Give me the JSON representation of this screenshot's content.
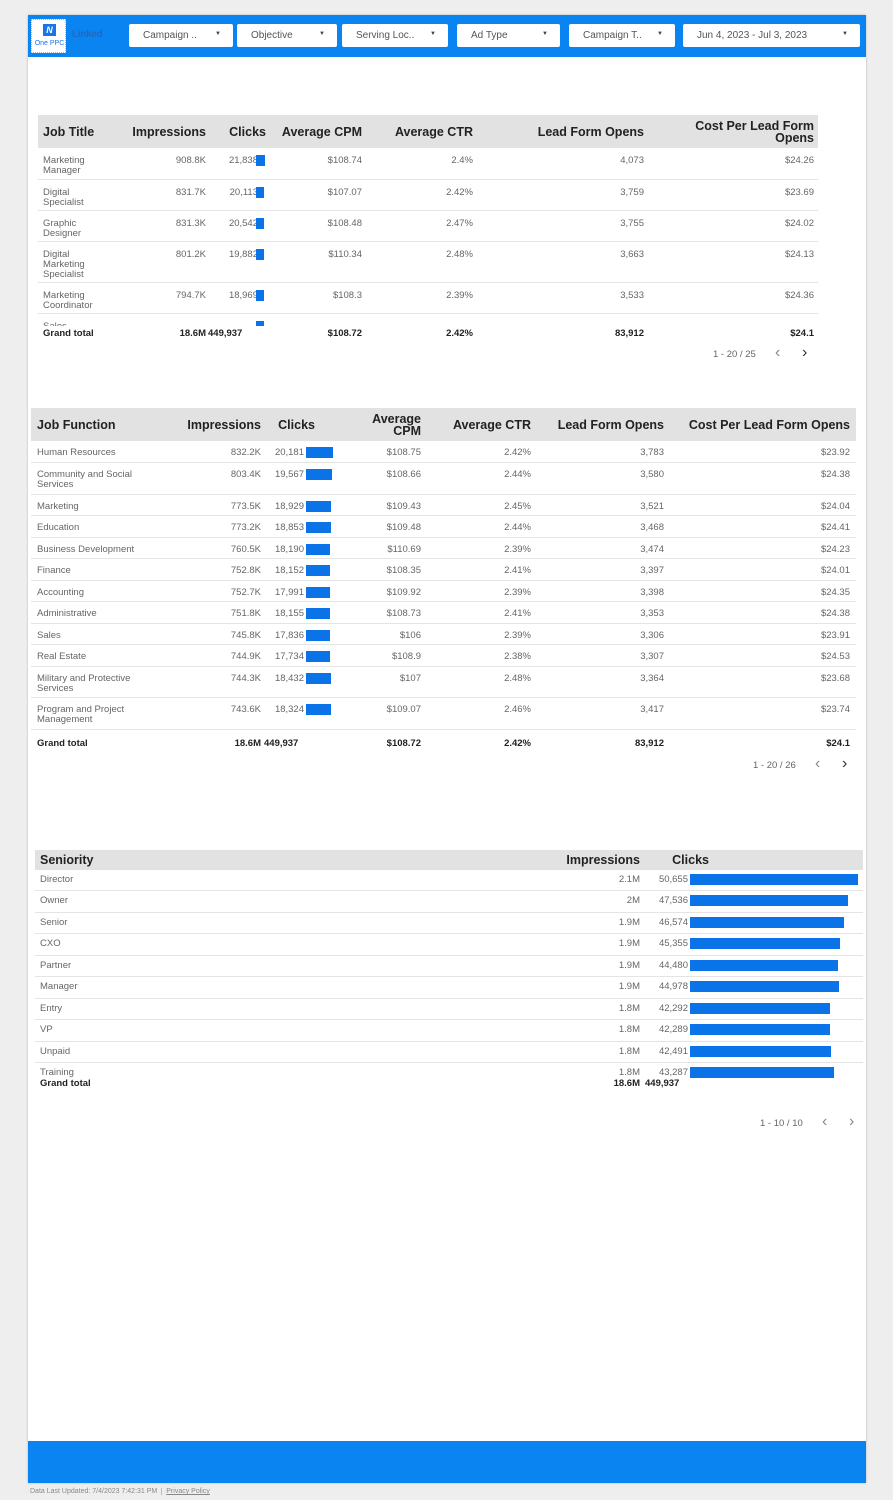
{
  "header": {
    "logo_text": "One PPC",
    "logo_mark": "N",
    "platform_label": "Linked",
    "filters": [
      {
        "label": "Campaign ..",
        "left": 0
      },
      {
        "label": "Objective"
      },
      {
        "label": "Serving Loc.."
      },
      {
        "label": "Ad Type"
      },
      {
        "label": "Campaign T.."
      },
      {
        "label": "Jun 4, 2023 - Jul 3, 2023"
      }
    ]
  },
  "colors": {
    "brand": "#0a84f0",
    "bar": "#0a73e8",
    "header_bg": "#e2e2e2"
  },
  "job_title_table": {
    "headers": [
      "Job Title",
      "Impressions",
      "Clicks",
      "Average CPM",
      "Average CTR",
      "Lead Form Opens",
      "Cost Per Lead Form Opens"
    ],
    "rows": [
      {
        "name": "Marketing Manager",
        "impressions": "908.8K",
        "clicks": "21,838",
        "clicks_value": 21838,
        "cpm": "$108.74",
        "ctr": "2.4%",
        "lfo": "4,073",
        "cplfo": "$24.26"
      },
      {
        "name": "Digital Specialist",
        "impressions": "831.7K",
        "clicks": "20,113",
        "clicks_value": 20113,
        "cpm": "$107.07",
        "ctr": "2.42%",
        "lfo": "3,759",
        "cplfo": "$23.69"
      },
      {
        "name": "Graphic Designer",
        "impressions": "831.3K",
        "clicks": "20,542",
        "clicks_value": 20542,
        "cpm": "$108.48",
        "ctr": "2.47%",
        "lfo": "3,755",
        "cplfo": "$24.02"
      },
      {
        "name": "Digital Marketing Specialist",
        "impressions": "801.2K",
        "clicks": "19,882",
        "clicks_value": 19882,
        "cpm": "$110.34",
        "ctr": "2.48%",
        "lfo": "3,663",
        "cplfo": "$24.13"
      },
      {
        "name": "Marketing Coordinator",
        "impressions": "794.7K",
        "clicks": "18,969",
        "clicks_value": 18969,
        "cpm": "$108.3",
        "ctr": "2.39%",
        "lfo": "3,533",
        "cplfo": "$24.36"
      },
      {
        "name": "Sales",
        "impressions": "",
        "clicks": "",
        "clicks_value": 19000,
        "cpm": "",
        "ctr": "",
        "lfo": "",
        "cplfo": ""
      }
    ],
    "total": {
      "name": "Grand total",
      "impressions": "18.6M",
      "clicks": "449,937",
      "cpm": "$108.72",
      "ctr": "2.42%",
      "lfo": "83,912",
      "cplfo": "$24.1"
    },
    "pagination": "1 - 20 / 25"
  },
  "job_function_table": {
    "headers": [
      "Job Function",
      "Impressions",
      "Clicks",
      "Average CPM",
      "Average CTR",
      "Lead Form Opens",
      "Cost Per Lead Form Opens"
    ],
    "rows": [
      {
        "name": "Human Resources",
        "impressions": "832.2K",
        "clicks": "20,181",
        "clicks_value": 20181,
        "cpm": "$108.75",
        "ctr": "2.42%",
        "lfo": "3,783",
        "cplfo": "$23.92"
      },
      {
        "name": "Community and Social Services",
        "impressions": "803.4K",
        "clicks": "19,567",
        "clicks_value": 19567,
        "cpm": "$108.66",
        "ctr": "2.44%",
        "lfo": "3,580",
        "cplfo": "$24.38"
      },
      {
        "name": "Marketing",
        "impressions": "773.5K",
        "clicks": "18,929",
        "clicks_value": 18929,
        "cpm": "$109.43",
        "ctr": "2.45%",
        "lfo": "3,521",
        "cplfo": "$24.04"
      },
      {
        "name": "Education",
        "impressions": "773.2K",
        "clicks": "18,853",
        "clicks_value": 18853,
        "cpm": "$109.48",
        "ctr": "2.44%",
        "lfo": "3,468",
        "cplfo": "$24.41"
      },
      {
        "name": "Business Development",
        "impressions": "760.5K",
        "clicks": "18,190",
        "clicks_value": 18190,
        "cpm": "$110.69",
        "ctr": "2.39%",
        "lfo": "3,474",
        "cplfo": "$24.23"
      },
      {
        "name": "Finance",
        "impressions": "752.8K",
        "clicks": "18,152",
        "clicks_value": 18152,
        "cpm": "$108.35",
        "ctr": "2.41%",
        "lfo": "3,397",
        "cplfo": "$24.01"
      },
      {
        "name": "Accounting",
        "impressions": "752.7K",
        "clicks": "17,991",
        "clicks_value": 17991,
        "cpm": "$109.92",
        "ctr": "2.39%",
        "lfo": "3,398",
        "cplfo": "$24.35"
      },
      {
        "name": "Administrative",
        "impressions": "751.8K",
        "clicks": "18,155",
        "clicks_value": 18155,
        "cpm": "$108.73",
        "ctr": "2.41%",
        "lfo": "3,353",
        "cplfo": "$24.38"
      },
      {
        "name": "Sales",
        "impressions": "745.8K",
        "clicks": "17,836",
        "clicks_value": 17836,
        "cpm": "$106",
        "ctr": "2.39%",
        "lfo": "3,306",
        "cplfo": "$23.91"
      },
      {
        "name": "Real Estate",
        "impressions": "744.9K",
        "clicks": "17,734",
        "clicks_value": 17734,
        "cpm": "$108.9",
        "ctr": "2.38%",
        "lfo": "3,307",
        "cplfo": "$24.53"
      },
      {
        "name": "Military and Protective Services",
        "impressions": "744.3K",
        "clicks": "18,432",
        "clicks_value": 18432,
        "cpm": "$107",
        "ctr": "2.48%",
        "lfo": "3,364",
        "cplfo": "$23.68"
      },
      {
        "name": "Program and Project Management",
        "impressions": "743.6K",
        "clicks": "18,324",
        "clicks_value": 18324,
        "cpm": "$109.07",
        "ctr": "2.46%",
        "lfo": "3,417",
        "cplfo": "$23.74"
      }
    ],
    "total": {
      "name": "Grand total",
      "impressions": "18.6M",
      "clicks": "449,937",
      "cpm": "$108.72",
      "ctr": "2.42%",
      "lfo": "83,912",
      "cplfo": "$24.1"
    },
    "pagination": "1 - 20 / 26"
  },
  "seniority_table": {
    "headers": [
      "Seniority",
      "Impressions",
      "Clicks"
    ],
    "rows": [
      {
        "name": "Director",
        "impressions": "2.1M",
        "clicks": "50,655",
        "clicks_value": 50655
      },
      {
        "name": "Owner",
        "impressions": "2M",
        "clicks": "47,536",
        "clicks_value": 47536
      },
      {
        "name": "Senior",
        "impressions": "1.9M",
        "clicks": "46,574",
        "clicks_value": 46574
      },
      {
        "name": "CXO",
        "impressions": "1.9M",
        "clicks": "45,355",
        "clicks_value": 45355
      },
      {
        "name": "Partner",
        "impressions": "1.9M",
        "clicks": "44,480",
        "clicks_value": 44480
      },
      {
        "name": "Manager",
        "impressions": "1.9M",
        "clicks": "44,978",
        "clicks_value": 44978
      },
      {
        "name": "Entry",
        "impressions": "1.8M",
        "clicks": "42,292",
        "clicks_value": 42292
      },
      {
        "name": "VP",
        "impressions": "1.8M",
        "clicks": "42,289",
        "clicks_value": 42289
      },
      {
        "name": "Unpaid",
        "impressions": "1.8M",
        "clicks": "42,491",
        "clicks_value": 42491
      },
      {
        "name": "Training",
        "impressions": "1.8M",
        "clicks": "43,287",
        "clicks_value": 43287
      }
    ],
    "total": {
      "name": "Grand total",
      "impressions": "18.6M",
      "clicks": "449,937"
    },
    "pagination": "1 - 10 / 10"
  },
  "footer": {
    "updated": "Data Last Updated: 7/4/2023 7:42:31 PM",
    "privacy": "Privacy Policy"
  }
}
